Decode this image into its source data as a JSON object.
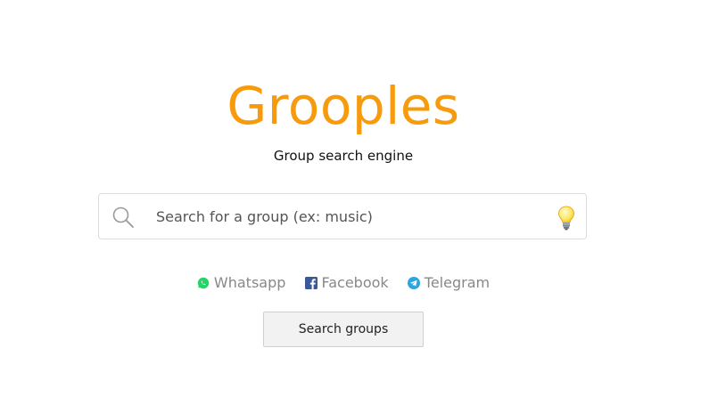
{
  "brand": {
    "logo_text": "Grooples",
    "tagline": "Group search engine",
    "color": "#f79b0d"
  },
  "search": {
    "placeholder": "Search for a group (ex: music)",
    "value": "",
    "search_icon": "magnifier-icon",
    "suggest_icon": "lightbulb-icon"
  },
  "platforms": [
    {
      "label": "Whatsapp",
      "icon": "whatsapp-icon",
      "color": "#25d366"
    },
    {
      "label": "Facebook",
      "icon": "facebook-icon",
      "color": "#3b5998"
    },
    {
      "label": "Telegram",
      "icon": "telegram-icon",
      "color": "#2ca5e0"
    }
  ],
  "actions": {
    "search_button_label": "Search groups"
  }
}
